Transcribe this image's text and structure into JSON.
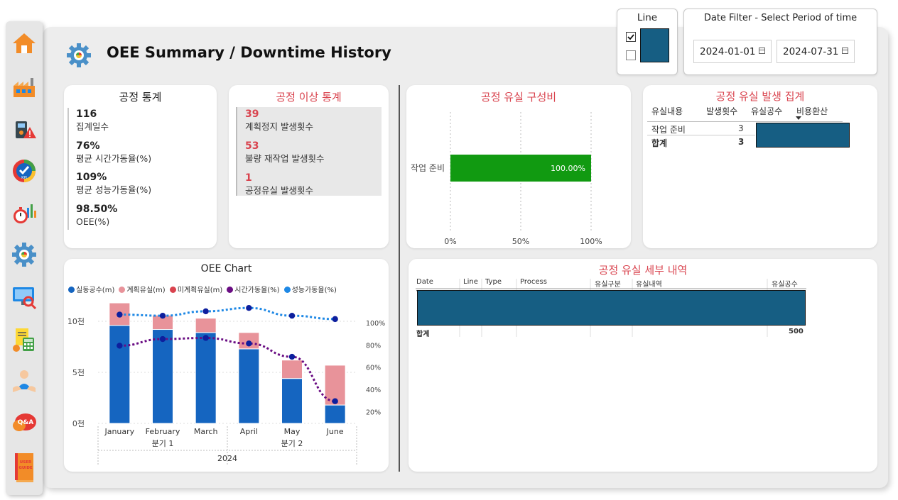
{
  "page": {
    "title": "OEE Summary / Downtime History"
  },
  "sidebar": {
    "icons": [
      "home-icon",
      "factory-icon",
      "machine-alert-icon",
      "kpi-icon",
      "stopwatch-chart-icon",
      "gear-icon",
      "monitor-search-icon",
      "calculator-icon",
      "person-icon",
      "qa-icon",
      "user-guide-icon"
    ],
    "qa_label": "Q&A",
    "guide_label": "USER GUIDE"
  },
  "line_filter": {
    "title": "Line",
    "accent": "#165e83"
  },
  "date_filter": {
    "title": "Date Filter - Select Period of time",
    "start": "2024-01-01",
    "end": "2024-07-31"
  },
  "process_stats": {
    "title": "공정 통계",
    "items": [
      {
        "value": "116",
        "label": "집계일수"
      },
      {
        "value": "76%",
        "label": "평균 시간가동율(%)"
      },
      {
        "value": "109%",
        "label": "평균 성능가동율(%)"
      },
      {
        "value": "98.50%",
        "label": "OEE(%)"
      }
    ]
  },
  "anomaly_stats": {
    "title": "공정 이상 통계",
    "items": [
      {
        "value": "39",
        "label": "계획정지 발생횟수"
      },
      {
        "value": "53",
        "label": "불량 재작업 발생횟수"
      },
      {
        "value": "1",
        "label": "공정유실 발생횟수"
      }
    ]
  },
  "loss_composition": {
    "title": "공정 유실 구성비",
    "chart_data": {
      "type": "bar",
      "orientation": "horizontal",
      "categories": [
        "작업 준비"
      ],
      "values": [
        100
      ],
      "data_labels": [
        "100.00%"
      ],
      "xticks": [
        "0%",
        "50%",
        "100%"
      ],
      "xlim": [
        0,
        100
      ],
      "color": "#119a11"
    }
  },
  "loss_summary": {
    "title": "공정 유실 발생 집계",
    "columns": [
      "유실내용",
      "발생횟수",
      "유실공수",
      "비용환산"
    ],
    "rows": [
      {
        "name": "작업 준비",
        "count": "3"
      }
    ],
    "total": {
      "name": "합계",
      "count": "3"
    }
  },
  "oee_chart": {
    "title": "OEE Chart",
    "chart_data": {
      "type": "bar",
      "categories": [
        "January",
        "February",
        "March",
        "April",
        "May",
        "June"
      ],
      "quarters": [
        "분기 1",
        "분기 2"
      ],
      "year": "2024",
      "series": [
        {
          "name": "실동공수(m)",
          "color": "#1565c0",
          "values": [
            9600,
            9200,
            8900,
            7300,
            4400,
            1800
          ]
        },
        {
          "name": "계획유실(m)",
          "color": "#e8939a",
          "values": [
            2200,
            1400,
            1400,
            1600,
            1800,
            3900
          ]
        },
        {
          "name": "미계획유실(m)",
          "color": "#d9434e",
          "values": [
            0,
            0,
            0,
            0,
            0,
            0
          ]
        }
      ],
      "lines": [
        {
          "name": "시간가동율(%)",
          "color": "#6a0d83",
          "values": [
            80,
            86,
            87,
            82,
            70,
            30
          ]
        },
        {
          "name": "성능가동율(%)",
          "color": "#1e88e5",
          "values": [
            108,
            107,
            111,
            114,
            107,
            104
          ]
        }
      ],
      "y_left": {
        "ticks": [
          "0천",
          "5천",
          "10천"
        ],
        "range": [
          0,
          12500
        ]
      },
      "y_right": {
        "ticks": [
          "20%",
          "40%",
          "60%",
          "80%",
          "100%"
        ],
        "range": [
          10,
          125
        ]
      }
    }
  },
  "loss_details": {
    "title": "공정 유실 세부 내역",
    "columns": [
      "Date",
      "Line",
      "Type",
      "Process",
      "유실구분",
      "유실내역",
      "유실공수"
    ],
    "total": {
      "label": "합계",
      "value": "500"
    }
  },
  "colors": {
    "accent": "#165e83",
    "title_red": "#d9434e",
    "bar_green": "#119a11"
  }
}
